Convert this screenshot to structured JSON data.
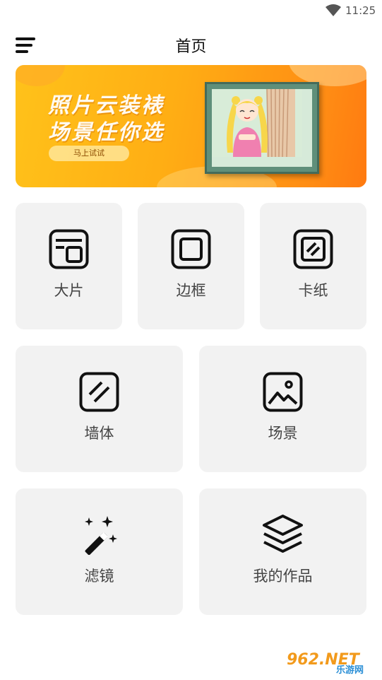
{
  "status_bar": {
    "time": "11:25",
    "wifi_icon": "wifi-icon"
  },
  "header": {
    "title": "首页",
    "menu_icon": "menu-icon"
  },
  "banner": {
    "line1": "照片云装裱",
    "line2": "场景任你选",
    "button_label": "马上试试"
  },
  "grid": {
    "row1": [
      {
        "label": "大片",
        "icon": "large-photo-icon"
      },
      {
        "label": "边框",
        "icon": "border-frame-icon"
      },
      {
        "label": "卡纸",
        "icon": "cardboard-icon"
      }
    ],
    "row2": [
      {
        "label": "墙体",
        "icon": "wall-icon"
      },
      {
        "label": "场景",
        "icon": "scene-image-icon"
      }
    ],
    "row3": [
      {
        "label": "滤镜",
        "icon": "magic-wand-icon"
      },
      {
        "label": "我的作品",
        "icon": "layers-icon"
      }
    ]
  },
  "watermark": {
    "text": "962.NET",
    "subtext": "乐游网"
  },
  "colors": {
    "banner_start": "#ffc21a",
    "banner_end": "#ff7a10",
    "card_bg": "#f2f2f2"
  }
}
